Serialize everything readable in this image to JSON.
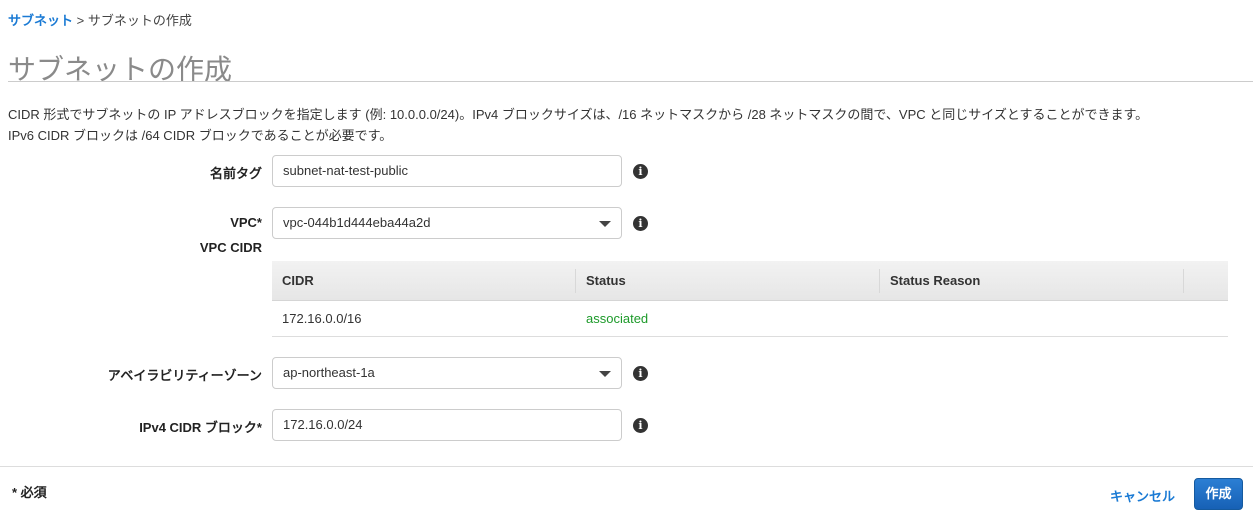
{
  "breadcrumb": {
    "link": "サブネット",
    "separator": ">",
    "current": "サブネットの作成"
  },
  "title": "サブネットの作成",
  "description": [
    "CIDR 形式でサブネットの IP アドレスブロックを指定します (例: 10.0.0.0/24)。IPv4 ブロックサイズは、/16 ネットマスクから /28 ネットマスクの間で、VPC と同じサイズとすることができます。",
    "IPv6 CIDR ブロックは /64 CIDR ブロックであることが必要です。"
  ],
  "form": {
    "name_tag": {
      "label": "名前タグ",
      "value": "subnet-nat-test-public"
    },
    "vpc": {
      "label": "VPC*",
      "value": "vpc-044b1d444eba44a2d"
    },
    "vpc_cidr": {
      "label": "VPC CIDR",
      "columns": [
        "CIDR",
        "Status",
        "Status Reason"
      ],
      "rows": [
        {
          "cidr": "172.16.0.0/16",
          "status": "associated",
          "reason": ""
        }
      ]
    },
    "az": {
      "label": "アベイラビリティーゾーン",
      "value": "ap-northeast-1a"
    },
    "ipv4": {
      "label": "IPv4 CIDR ブロック*",
      "value": "172.16.0.0/24"
    }
  },
  "icons": {
    "info": "i"
  },
  "footer": {
    "required": "* 必須",
    "cancel": "キャンセル",
    "create": "作成"
  },
  "colors": {
    "link": "#1a7ad4",
    "status_ok": "#1d9a2a",
    "primary": "#1d6fc4"
  }
}
